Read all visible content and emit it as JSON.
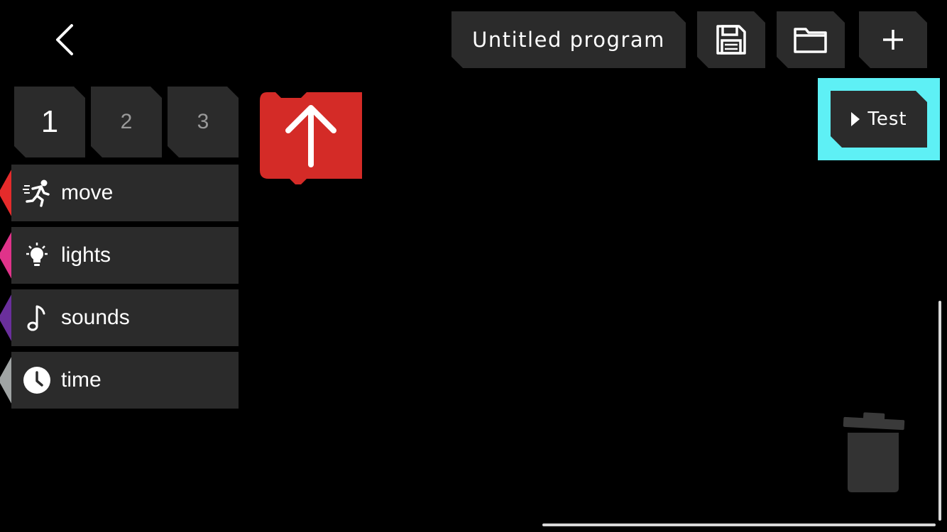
{
  "header": {
    "back_icon": "chevron-left-icon",
    "program_title": "Untitled program",
    "save_icon": "floppy-disk-icon",
    "open_icon": "folder-icon",
    "add_icon": "plus-icon"
  },
  "test_button": {
    "label": "Test",
    "icon": "play-triangle-icon",
    "highlight_color": "#5ef0f5"
  },
  "page_tabs": [
    {
      "label": "1",
      "active": true
    },
    {
      "label": "2",
      "active": false
    },
    {
      "label": "3",
      "active": false
    }
  ],
  "categories": [
    {
      "label": "move",
      "icon": "running-person-icon",
      "color": "#e52b2b"
    },
    {
      "label": "lights",
      "icon": "lightbulb-icon",
      "color": "#e0338a"
    },
    {
      "label": "sounds",
      "icon": "music-note-icon",
      "color": "#6a2f9c"
    },
    {
      "label": "time",
      "icon": "clock-icon",
      "color": "#a0a4a4"
    }
  ],
  "canvas": {
    "block": {
      "type": "move-forward",
      "icon": "arrow-up-icon",
      "color": "#d42b27"
    },
    "trash_icon": "trash-can-icon"
  }
}
